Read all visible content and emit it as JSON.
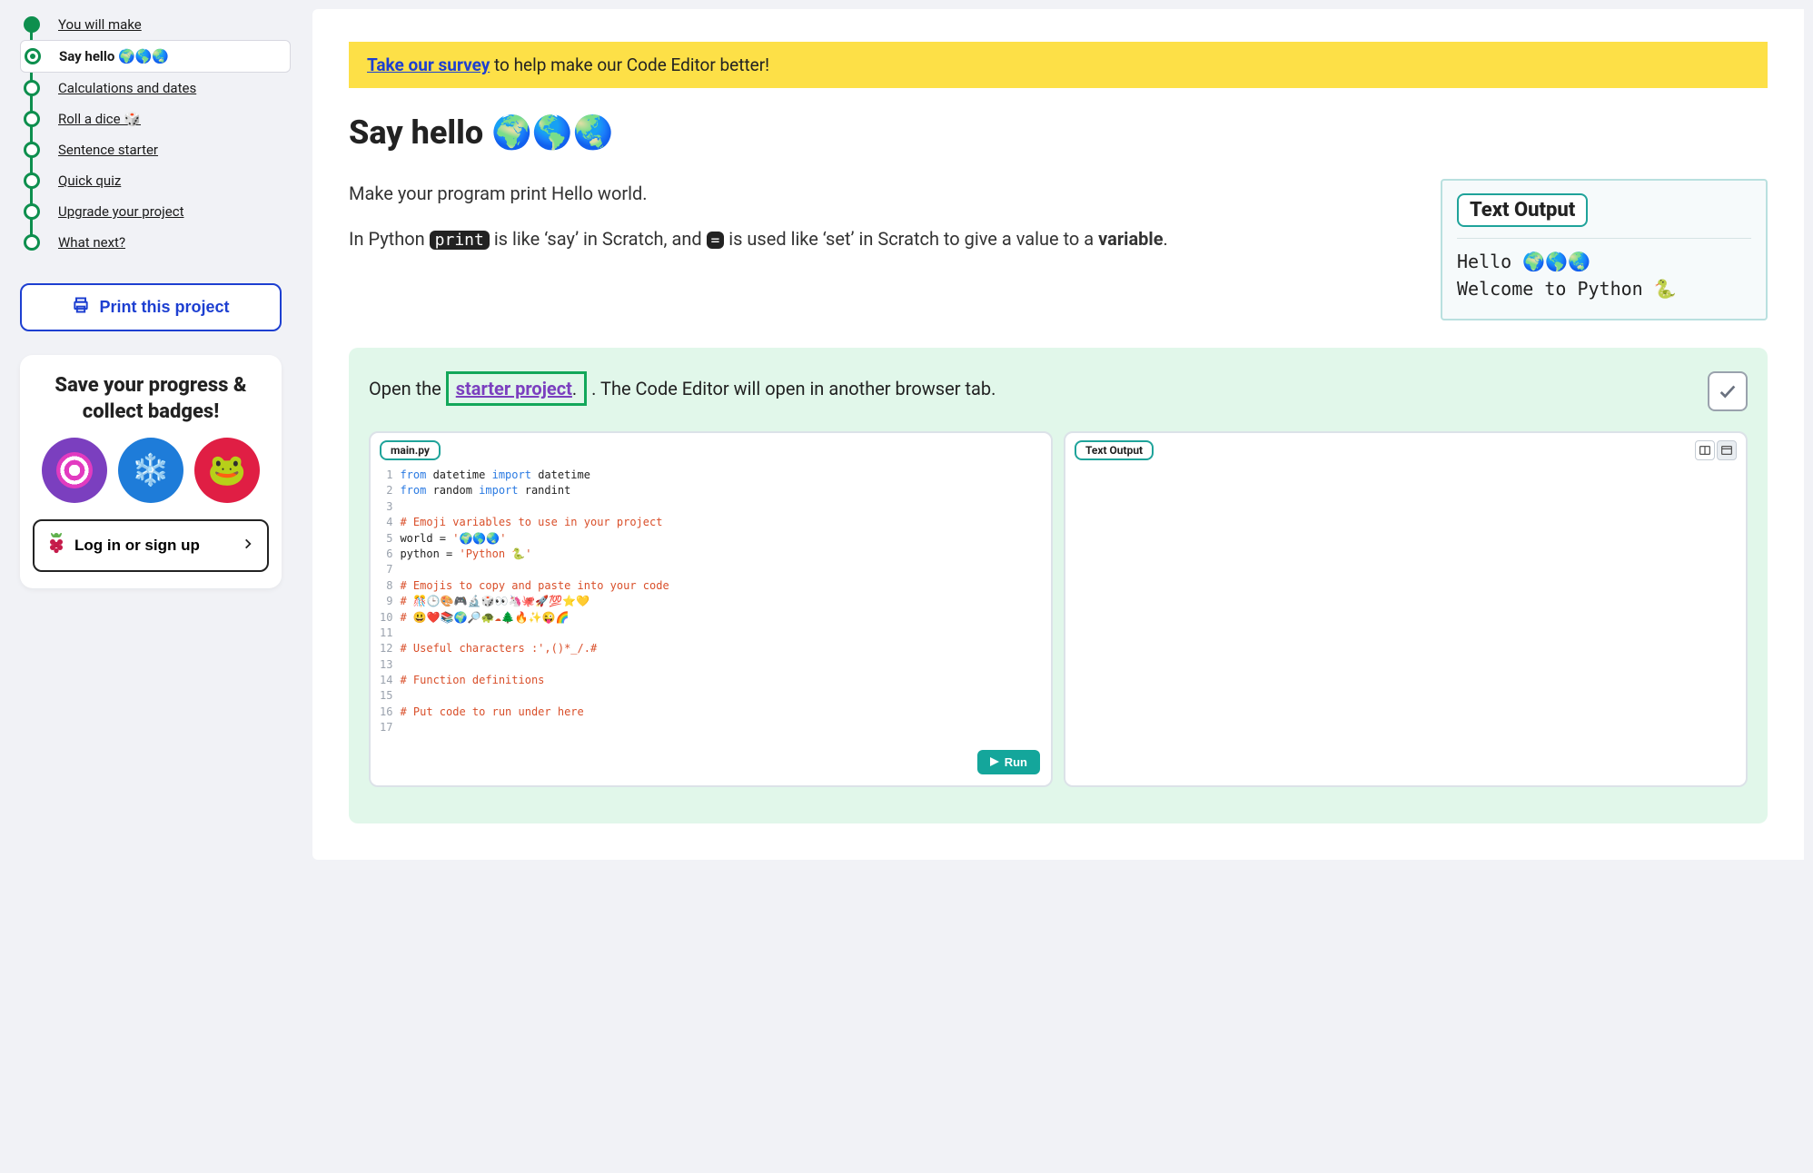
{
  "sidebar": {
    "steps": [
      {
        "label": "You will make",
        "state": "done"
      },
      {
        "label": "Say hello 🌍🌎🌏",
        "state": "current"
      },
      {
        "label": "Calculations and dates",
        "state": "todo"
      },
      {
        "label": "Roll a dice 🎲",
        "state": "todo"
      },
      {
        "label": "Sentence starter",
        "state": "todo"
      },
      {
        "label": "Quick quiz",
        "state": "todo"
      },
      {
        "label": "Upgrade your project",
        "state": "todo"
      },
      {
        "label": "What next?",
        "state": "todo"
      }
    ],
    "print_label": "Print this project",
    "progress_heading": "Save your progress & collect badges!",
    "login_label": "Log in or sign up"
  },
  "survey": {
    "link_text": "Take our survey",
    "rest": " to help make our Code Editor better!"
  },
  "page_title": "Say hello 🌍🌎🌏",
  "intro": {
    "p1": "Make your program print Hello world.",
    "p2_pre": "In Python ",
    "p2_chip1": "print",
    "p2_mid": " is like ‘say’ in Scratch, and ",
    "p2_chip2": "=",
    "p2_post": " is used like ‘set’ in Scratch to give a value to a ",
    "p2_bold": "variable",
    "p2_tail": "."
  },
  "text_output_card": {
    "tag": "Text Output",
    "lines": "Hello 🌍🌎🌏\nWelcome to Python 🐍"
  },
  "task": {
    "open_pre": "Open the ",
    "starter_link": "starter project",
    "open_post": ". The Code Editor will open in another browser tab."
  },
  "ide": {
    "code_tab": "main.py",
    "out_tab": "Text Output",
    "run_label": "Run",
    "code_lines": [
      {
        "kind": "code",
        "tokens": [
          [
            "kw",
            "from "
          ],
          [
            "id",
            "datetime "
          ],
          [
            "kw",
            "import "
          ],
          [
            "id",
            "datetime"
          ]
        ]
      },
      {
        "kind": "code",
        "tokens": [
          [
            "kw",
            "from "
          ],
          [
            "id",
            "random "
          ],
          [
            "kw",
            "import "
          ],
          [
            "id",
            "randint"
          ]
        ]
      },
      {
        "kind": "blank"
      },
      {
        "kind": "comment",
        "text": "# Emoji variables to use in your project"
      },
      {
        "kind": "code",
        "tokens": [
          [
            "id",
            "world = "
          ],
          [
            "str",
            "'🌍🌎🌏'"
          ]
        ]
      },
      {
        "kind": "code",
        "tokens": [
          [
            "id",
            "python = "
          ],
          [
            "str",
            "'Python 🐍'"
          ]
        ]
      },
      {
        "kind": "blank"
      },
      {
        "kind": "comment",
        "text": "# Emojis to copy and paste into your code"
      },
      {
        "kind": "comment",
        "text": "# 🎊🕒🎨🎮🔬🎲👀🦄🐙🚀💯⭐💛"
      },
      {
        "kind": "comment",
        "text": "# 😃❤️📚🌍🔎🐢☁🌲🔥✨😜🌈"
      },
      {
        "kind": "blank"
      },
      {
        "kind": "comment",
        "text": "# Useful characters :',()*_/.#"
      },
      {
        "kind": "blank"
      },
      {
        "kind": "comment",
        "text": "# Function definitions"
      },
      {
        "kind": "blank"
      },
      {
        "kind": "comment",
        "text": "# Put code to run under here"
      },
      {
        "kind": "blank"
      }
    ]
  }
}
